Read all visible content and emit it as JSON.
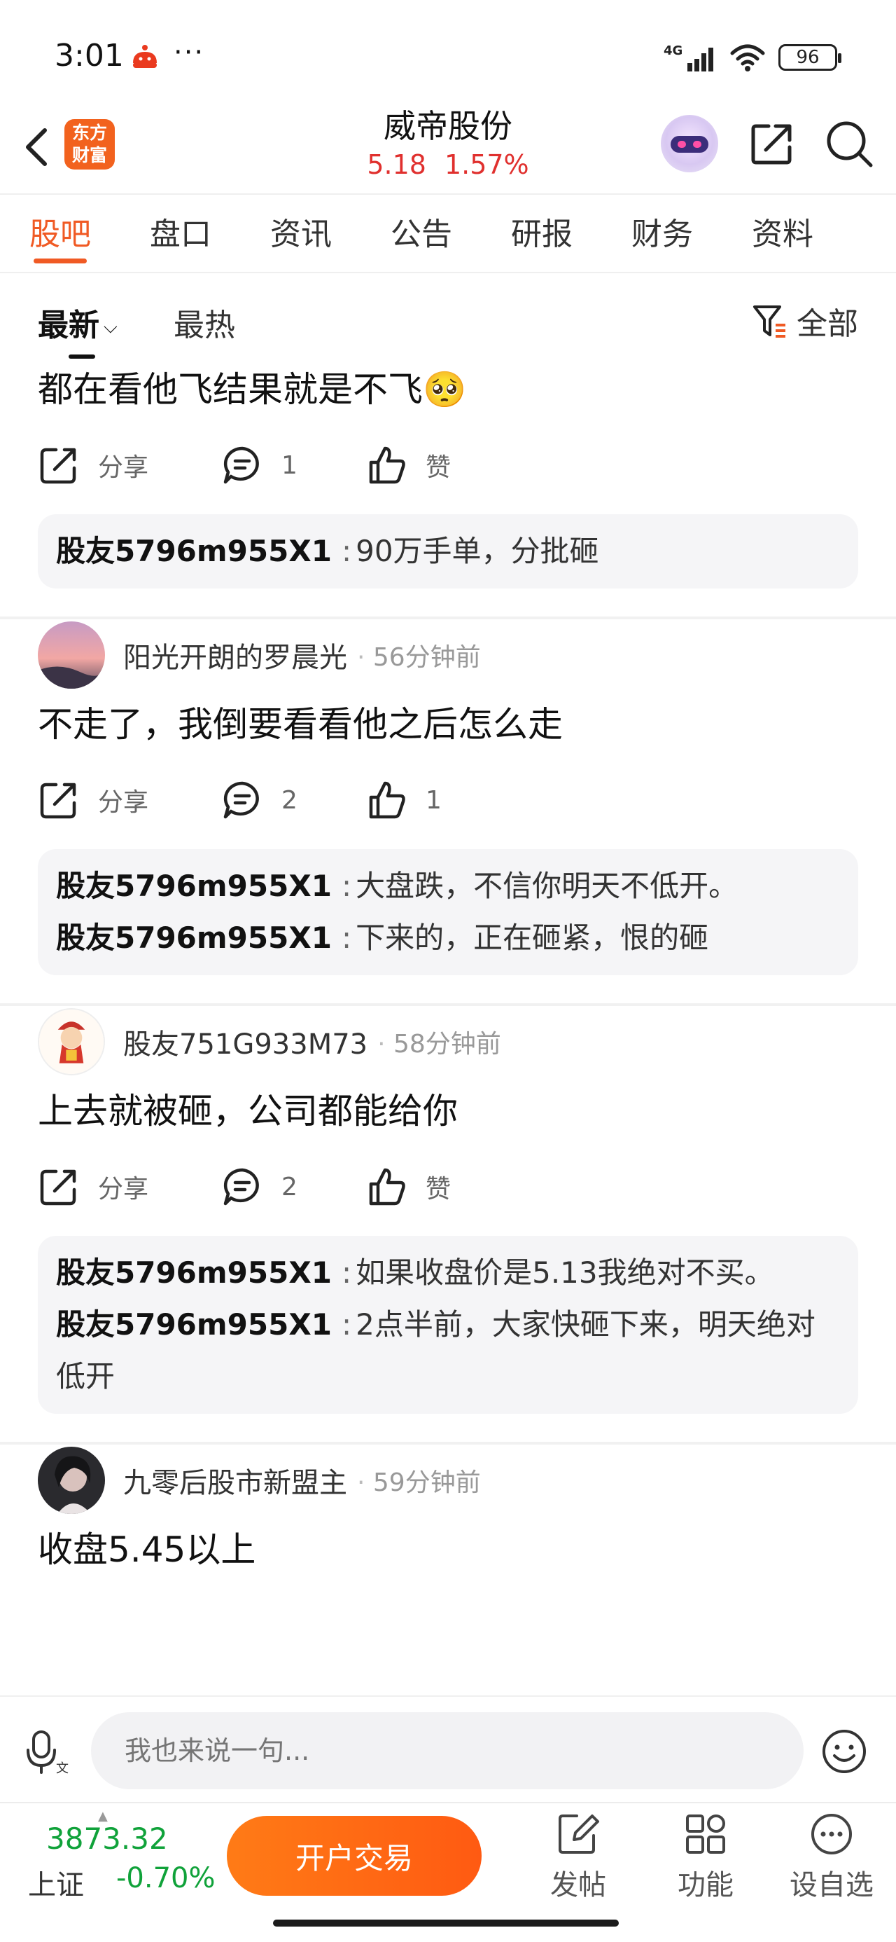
{
  "status_bar": {
    "time": "3:01",
    "more": "···",
    "network": "4G",
    "battery": "96"
  },
  "header": {
    "app_logo": "东方财富",
    "stock_name": "威帝股份",
    "price": "5.18",
    "change_pct": "1.57%"
  },
  "tabs": [
    "股吧",
    "盘口",
    "资讯",
    "公告",
    "研报",
    "财务",
    "资料"
  ],
  "sort": {
    "latest": "最新",
    "hot": "最热",
    "filter": "全部"
  },
  "posts": [
    {
      "text": "都在看他飞结果就是不飞🥺",
      "share_label": "分享",
      "comment_count": "1",
      "like_label": "赞",
      "comments": [
        {
          "user": "股友5796m955X1",
          "text": "90万手单，分批砸"
        }
      ]
    },
    {
      "author": "阳光开朗的罗晨光",
      "time": "56分钟前",
      "text": "不走了，我倒要看看他之后怎么走",
      "share_label": "分享",
      "comment_count": "2",
      "like_label": "1",
      "comments": [
        {
          "user": "股友5796m955X1",
          "text": "大盘跌，不信你明天不低开。"
        },
        {
          "user": "股友5796m955X1",
          "text": "下来的，正在砸紧，恨的砸"
        }
      ]
    },
    {
      "author": "股友751G933M73",
      "time": "58分钟前",
      "text": "上去就被砸，公司都能给你",
      "share_label": "分享",
      "comment_count": "2",
      "like_label": "赞",
      "comments": [
        {
          "user": "股友5796m955X1",
          "text": "如果收盘价是5.13我绝对不买。"
        },
        {
          "user": "股友5796m955X1",
          "text": "2点半前，大家快砸下来，明天绝对低开"
        }
      ]
    },
    {
      "author": "九零后股市新盟主",
      "time": "59分钟前",
      "text": "收盘5.45以上"
    }
  ],
  "input": {
    "placeholder": "我也来说一句..."
  },
  "bottom": {
    "index_value": "3873.32",
    "index_name": "上证",
    "index_change": "-0.70%",
    "trade_button": "开户交易",
    "nav": [
      "发帖",
      "功能",
      "设自选"
    ]
  },
  "colors": {
    "accent": "#f05a24",
    "up": "#e0302e",
    "down": "#10a23a"
  }
}
